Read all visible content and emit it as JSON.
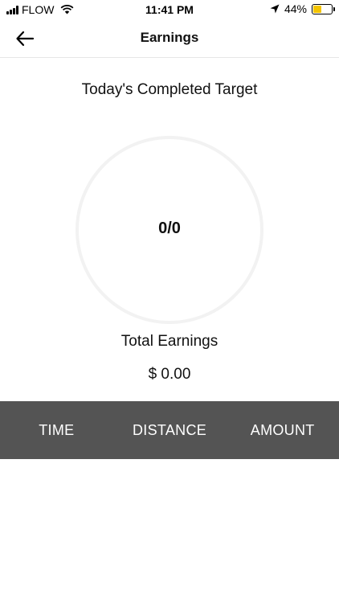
{
  "status_bar": {
    "carrier": "FLOW",
    "time": "11:41 PM",
    "battery_percent_label": "44%",
    "battery_level": 0.44
  },
  "header": {
    "title": "Earnings",
    "back_icon": "arrow-left-icon"
  },
  "target": {
    "title": "Today's Completed Target",
    "value": "0/0",
    "progress_fraction": 0
  },
  "earnings": {
    "label": "Total Earnings",
    "value": "$ 0.00"
  },
  "tabs": [
    {
      "label": "TIME"
    },
    {
      "label": "DISTANCE"
    },
    {
      "label": "AMOUNT"
    }
  ],
  "colors": {
    "tab_bar": "#545454",
    "ring": "#f2f2f2",
    "battery": "#f4c400"
  }
}
